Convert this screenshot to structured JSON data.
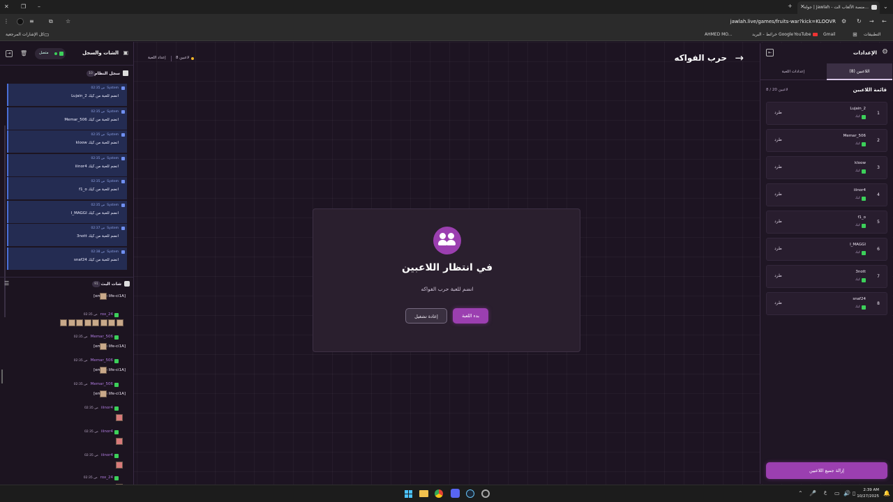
{
  "browser": {
    "tab_title": "جولة | Jawlah - منصة الألعاب الت...",
    "url": "jawlah.live/games/fruits-war?kick=KLOOVR",
    "bookmarks": [
      "التطبيقات",
      "Gmail",
      "YouTube",
      "خرائط Google",
      "البريد -",
      "AHMED MO..."
    ],
    "bookmarks_all": "كل الإشارات المرجعية"
  },
  "chat_panel": {
    "title": "الشات والسجل",
    "status": "متصل",
    "system_log": {
      "title": "سجل النظام",
      "count": "10",
      "entries": [
        {
          "source": "System",
          "time": "02:35 ص",
          "text": "Lujain_2 انضم للعبة من كيك"
        },
        {
          "source": "System",
          "time": "02:35 ص",
          "text": "Memar_506 انضم للعبة من كيك"
        },
        {
          "source": "System",
          "time": "02:35 ص",
          "text": "kloow انضم للعبة من كيك"
        },
        {
          "source": "System",
          "time": "02:35 ص",
          "text": "iiinor4 انضم للعبة من كيك"
        },
        {
          "source": "System",
          "time": "02:35 ص",
          "text": "f1_o انضم للعبة من كيك"
        },
        {
          "source": "System",
          "time": "02:35 ص",
          "text": "I_MAGGI انضم للعبة من كيك"
        },
        {
          "source": "System",
          "time": "02:37 ص",
          "text": "3nott انضم للعبة من كيك"
        },
        {
          "source": "System",
          "time": "02:38 ص",
          "text": "snaf24 انضم للعبة من كيك"
        }
      ]
    },
    "live_chat": {
      "title": "شات البث",
      "count": "91",
      "messages": [
        {
          "name": "",
          "time": "",
          "text": "[emote life-ci1A]"
        },
        {
          "name": "rox_24",
          "time": "02:35 ص",
          "text": ""
        },
        {
          "name": "Memar_506",
          "time": "02:35 ص",
          "text": "[emote life-ci1A]"
        },
        {
          "name": "Memar_506",
          "time": "02:35 ص",
          "text": "[emote life-ci1A]"
        },
        {
          "name": "Memar_506",
          "time": "02:35 ص",
          "text": "[emote life-ci1A]"
        },
        {
          "name": "iiinor4",
          "time": "02:35 ص",
          "text": ""
        },
        {
          "name": "iiinor4",
          "time": "02:35 ص",
          "text": ""
        },
        {
          "name": "iiinor4",
          "time": "02:35 ص",
          "text": ""
        },
        {
          "name": "rox_24",
          "time": "02:35 ص",
          "text": ""
        }
      ]
    }
  },
  "game_header": {
    "title": "حرب الفواكه",
    "players_count": "8 لاعبين",
    "game_settings_link": "إعداد اللعبة"
  },
  "modal": {
    "title": "في انتظار اللاعبين",
    "subtitle": "انضم للعبة حرب الفواكه",
    "start_label": "بدء اللعبة",
    "restart_label": "إعادة تشغيل"
  },
  "settings_panel": {
    "title": "الإعدادات",
    "tabs": [
      "اللاعبين (8)",
      "إعدادات اللعبة"
    ],
    "list_title": "قائمة اللاعبين",
    "list_count": "8 / 20 لاعبين",
    "kick_label": "طرد",
    "platform_label": "كيك",
    "players": [
      {
        "num": "1",
        "name": "Lujain_2"
      },
      {
        "num": "2",
        "name": "Memar_506"
      },
      {
        "num": "3",
        "name": "kloow"
      },
      {
        "num": "4",
        "name": "iiinor4"
      },
      {
        "num": "5",
        "name": "f1_o"
      },
      {
        "num": "6",
        "name": "I_MAGGI"
      },
      {
        "num": "7",
        "name": "3nott"
      },
      {
        "num": "8",
        "name": "snaf24"
      }
    ],
    "remove_all_label": "إزالة جميع اللاعبين"
  },
  "taskbar": {
    "time": "2:39 AM",
    "date": "10/27/2025",
    "lang": "ع"
  },
  "colors": {
    "accent": "#9b3fb0",
    "kick_green": "#3cd05a",
    "log_bg": "#242c52"
  }
}
